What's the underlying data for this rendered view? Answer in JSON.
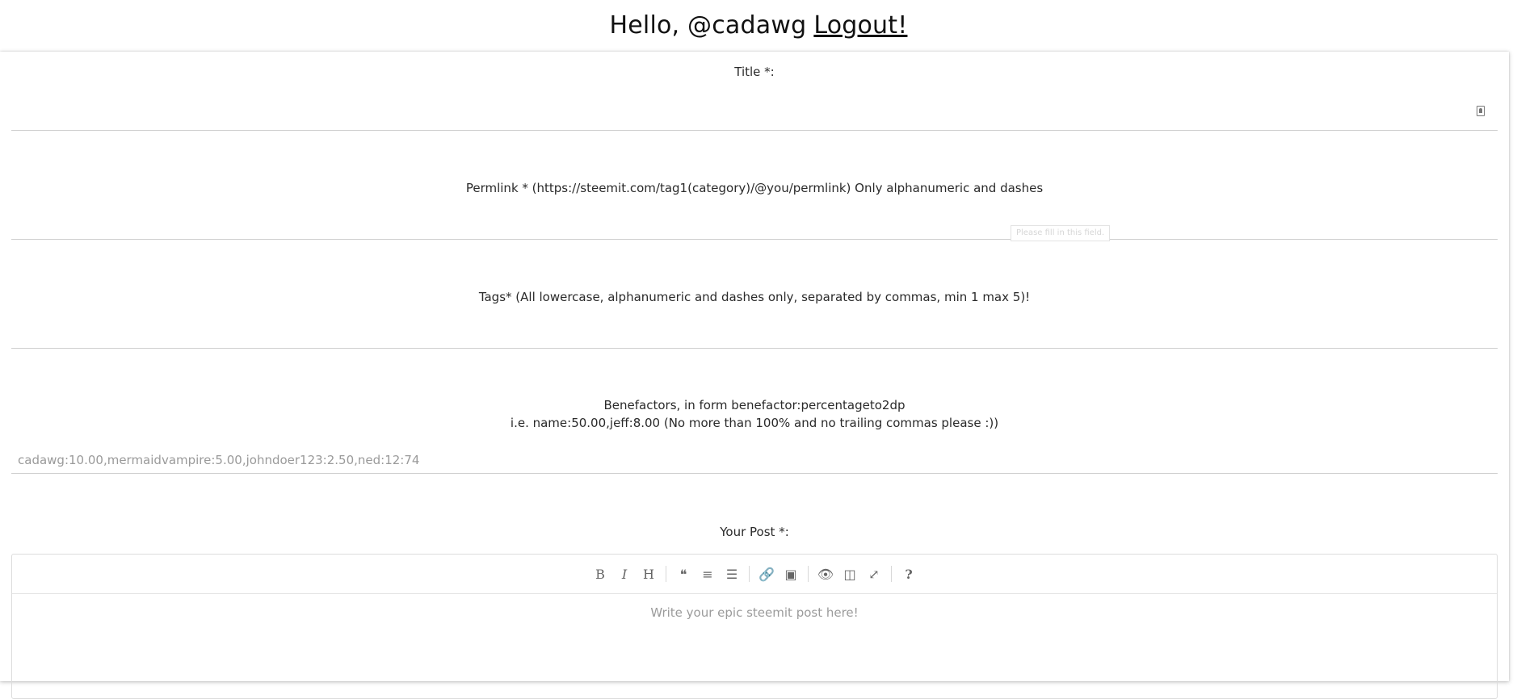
{
  "header": {
    "greeting": "Hello, @cadawg",
    "logout_label": "Logout!"
  },
  "form": {
    "title_label": "Title *:",
    "permlink_label": "Permlink * (https://steemit.com/tag1(category)/@you/permlink) Only alphanumeric and dashes",
    "tooltip": "Please fill in this field.",
    "tags_label": "Tags* (All lowercase, alphanumeric and dashes only, separated by commas, min 1 max 5)!",
    "benefactors_label_line1": "Benefactors, in form benefactor:percentageto2dp",
    "benefactors_label_line2": "i.e. name:50.00,jeff:8.00 (No more than 100% and no trailing commas please :))",
    "benefactors_placeholder": "cadawg:10.00,mermaidvampire:5.00,johndoer123:2.50,ned:12:74",
    "post_label": "Your Post *:"
  },
  "editor": {
    "placeholder": "Write your epic steemit post here!",
    "toolbar": [
      {
        "icon": "bold-icon",
        "glyph": "B"
      },
      {
        "icon": "italic-icon",
        "glyph": "I"
      },
      {
        "icon": "heading-icon",
        "glyph": "H"
      },
      {
        "icon": "quote-icon",
        "glyph": "❝"
      },
      {
        "icon": "unordered-list-icon",
        "glyph": "≡"
      },
      {
        "icon": "ordered-list-icon",
        "glyph": "☰"
      },
      {
        "icon": "link-icon",
        "glyph": "🔗"
      },
      {
        "icon": "image-icon",
        "glyph": "▣"
      },
      {
        "icon": "preview-icon",
        "glyph": "👁"
      },
      {
        "icon": "side-by-side-icon",
        "glyph": "◫"
      },
      {
        "icon": "fullscreen-icon",
        "glyph": "⤢"
      },
      {
        "icon": "help-icon",
        "glyph": "?"
      }
    ]
  }
}
